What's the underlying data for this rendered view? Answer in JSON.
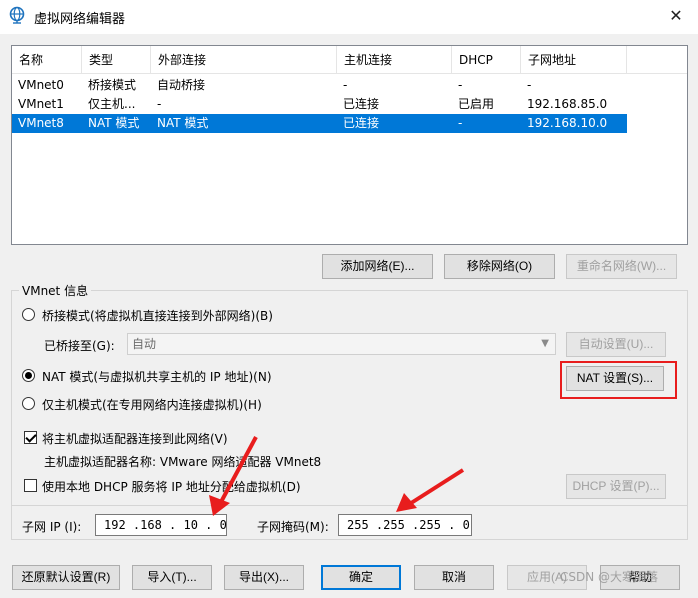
{
  "window": {
    "title": "虚拟网络编辑器",
    "close_glyph": "✕"
  },
  "table": {
    "columns": [
      "名称",
      "类型",
      "外部连接",
      "主机连接",
      "DHCP",
      "子网地址"
    ],
    "rows": [
      [
        "VMnet0",
        "桥接模式",
        "自动桥接",
        "-",
        "-",
        "-"
      ],
      [
        "VMnet1",
        "仅主机...",
        "-",
        "已连接",
        "已启用",
        "192.168.85.0"
      ],
      [
        "VMnet8",
        "NAT 模式",
        "NAT 模式",
        "已连接",
        "-",
        "192.168.10.0"
      ]
    ],
    "selected_row": 2
  },
  "list_buttons": {
    "add": "添加网络(E)...",
    "remove": "移除网络(O)",
    "rename": "重命名网络(W)..."
  },
  "vmnet_info": {
    "label": "VMnet 信息",
    "bridged_label": "桥接模式(将虚拟机直接连接到外部网络)(B)",
    "bridged_to_label": "已桥接至(G):",
    "bridged_to_value": "自动",
    "auto_settings": "自动设置(U)...",
    "nat_label": "NAT 模式(与虚拟机共享主机的 IP 地址)(N)",
    "nat_settings": "NAT 设置(S)...",
    "hostonly_label": "仅主机模式(在专用网络内连接虚拟机)(H)",
    "connect_adapter_label": "将主机虚拟适配器连接到此网络(V)",
    "adapter_name_label": "主机虚拟适配器名称: VMware 网络适配器 VMnet8",
    "dhcp_label": "使用本地 DHCP 服务将 IP 地址分配给虚拟机(D)",
    "dhcp_settings": "DHCP 设置(P)...",
    "subnet_ip_label": "子网 IP (I):",
    "subnet_ip_value": "192 .168 . 10 . 0",
    "subnet_mask_label": "子网掩码(M):",
    "subnet_mask_value": "255 .255 .255 . 0"
  },
  "selected_mode": "nat",
  "connect_adapter_checked": true,
  "dhcp_checked": false,
  "bottom_buttons": {
    "restore": "还原默认设置(R)",
    "import": "导入(T)...",
    "export": "导出(X)...",
    "ok": "确定",
    "cancel": "取消",
    "apply": "应用(A)",
    "help": "帮助"
  },
  "watermark": "CSDN @大寒雨落",
  "colors": {
    "selection": "#0078d7",
    "highlight_box": "#e81d1d",
    "title_icon": "#1e73be"
  }
}
